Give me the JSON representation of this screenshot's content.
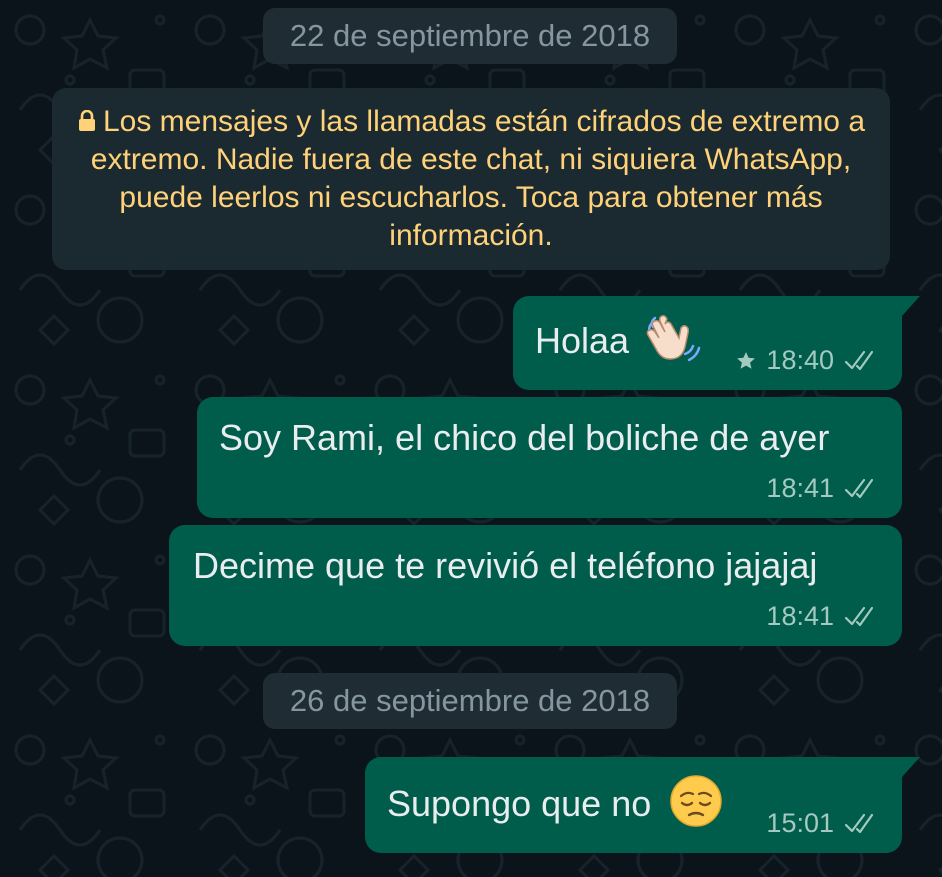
{
  "chat": {
    "date_1": "22 de septiembre de 2018",
    "encryption_notice": "Los mensajes y las llamadas están cifrados de extremo a extremo. Nadie fuera de este chat, ni siquiera WhatsApp, puede leerlos ni escucharlos. Toca para obtener más información.",
    "messages": [
      {
        "text": "Holaa",
        "emoji": "waving-hand",
        "time": "18:40",
        "starred": true,
        "status": "delivered"
      },
      {
        "text": "Soy Rami, el chico del boliche de ayer",
        "time": "18:41",
        "status": "delivered"
      },
      {
        "text": "Decime que te revivió el teléfono jajajaj",
        "time": "18:41",
        "status": "delivered"
      },
      {
        "text": "Supongo que no",
        "emoji": "pensive-face",
        "time": "15:01",
        "status": "delivered"
      }
    ],
    "date_2": "26 de septiembre de 2018"
  },
  "colors": {
    "background": "#0b141a",
    "outgoing_bubble": "#005c4b",
    "date_chip": "#1f2c33",
    "notice_text": "#ffd279",
    "meta_text": "#a3c9c0"
  }
}
